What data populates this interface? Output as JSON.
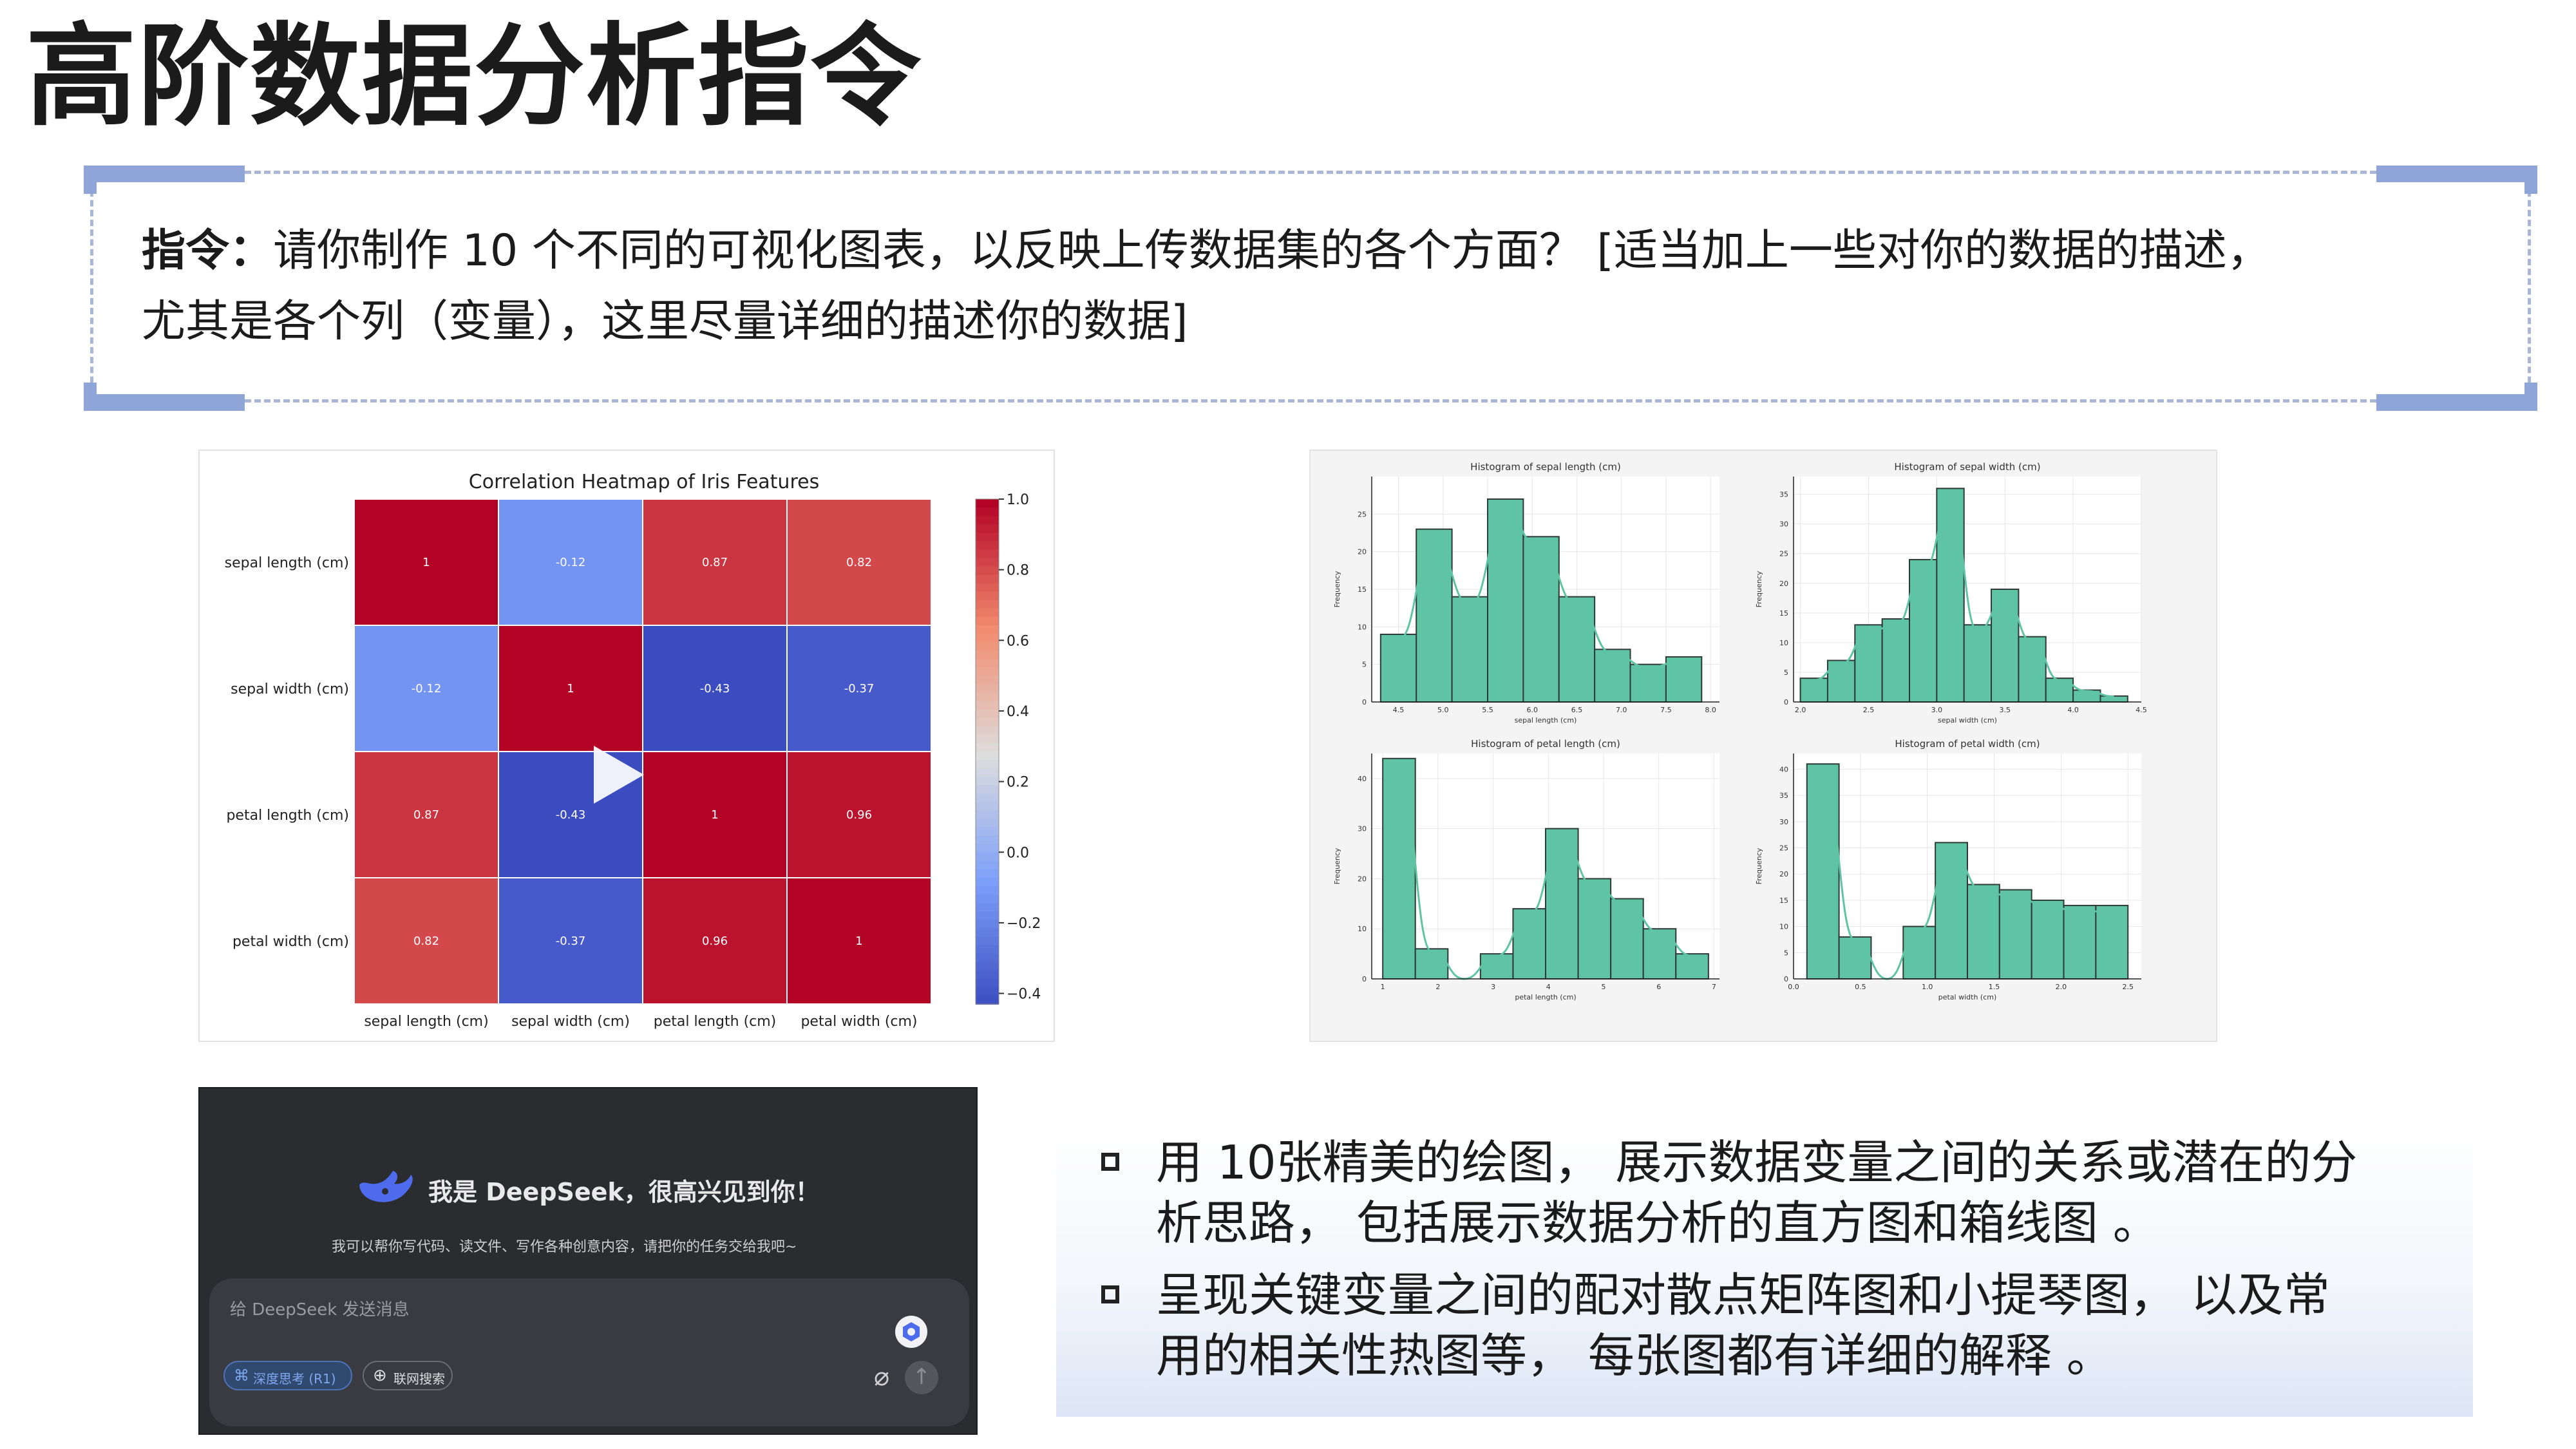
{
  "page": {
    "title": "高阶数据分析指令"
  },
  "instruction": {
    "label": "指令：",
    "line1": "请你制作 10 个不同的可视化图表，以反映上传数据集的各个方面？ [适当加上一些对你的数据的描述，",
    "line2": "尤其是各个列（变量），这里尽量详细的描述你的数据]"
  },
  "colors": {
    "accent": "#8fa5d8",
    "hist_fill": "#5fc4a3",
    "heat_high": "#b40426",
    "heat_low": "#3b4cc0"
  },
  "chart_data": [
    {
      "type": "heatmap",
      "title": "Correlation Heatmap of Iris Features",
      "rows": [
        "sepal length (cm)",
        "sepal width (cm)",
        "petal length (cm)",
        "petal width (cm)"
      ],
      "cols": [
        "sepal length (cm)",
        "sepal width (cm)",
        "petal length (cm)",
        "petal width (cm)"
      ],
      "values": [
        [
          1,
          -0.12,
          0.87,
          0.82
        ],
        [
          -0.12,
          1,
          -0.43,
          -0.37
        ],
        [
          0.87,
          -0.43,
          1,
          0.96
        ],
        [
          0.82,
          -0.37,
          0.96,
          1
        ]
      ],
      "labels": [
        [
          "1",
          "-0.12",
          "0.87",
          "0.82"
        ],
        [
          "-0.12",
          "1",
          "-0.43",
          "-0.37"
        ],
        [
          "0.87",
          "-0.43",
          "1",
          "0.96"
        ],
        [
          "0.82",
          "-0.37",
          "0.96",
          "1"
        ]
      ],
      "colorbar_ticks": [
        "1.0",
        "0.8",
        "0.6",
        "0.4",
        "0.2",
        "0.0",
        "−0.2",
        "−0.4"
      ],
      "colorbar_range": [
        -0.43,
        1.0
      ]
    },
    {
      "type": "bar",
      "title": "Histogram of sepal length (cm)",
      "xlabel": "sepal length (cm)",
      "ylabel": "Frequency",
      "xticks": [
        "4.5",
        "5.0",
        "5.5",
        "6.0",
        "6.5",
        "7.0",
        "7.5",
        "8.0"
      ],
      "yticks": [
        "0",
        "5",
        "10",
        "15",
        "20",
        "25"
      ],
      "xlim": [
        4.2,
        8.1
      ],
      "ylim": [
        0,
        30
      ],
      "bins": [
        [
          4.3,
          4.7,
          9
        ],
        [
          4.7,
          5.1,
          23
        ],
        [
          5.1,
          5.5,
          14
        ],
        [
          5.5,
          5.9,
          27
        ],
        [
          5.9,
          6.3,
          22
        ],
        [
          6.3,
          6.7,
          14
        ],
        [
          6.7,
          7.1,
          7
        ],
        [
          7.1,
          7.5,
          5
        ],
        [
          7.5,
          7.9,
          6
        ]
      ]
    },
    {
      "type": "bar",
      "title": "Histogram of sepal width (cm)",
      "xlabel": "sepal width (cm)",
      "ylabel": "Frequency",
      "xticks": [
        "2.0",
        "2.5",
        "3.0",
        "3.5",
        "4.0",
        "4.5"
      ],
      "yticks": [
        "0",
        "5",
        "10",
        "15",
        "20",
        "25",
        "30",
        "35"
      ],
      "xlim": [
        1.95,
        4.5
      ],
      "ylim": [
        0,
        38
      ],
      "bins": [
        [
          2.0,
          2.2,
          4
        ],
        [
          2.2,
          2.4,
          7
        ],
        [
          2.4,
          2.6,
          13
        ],
        [
          2.6,
          2.8,
          14
        ],
        [
          2.8,
          3.0,
          24
        ],
        [
          3.0,
          3.2,
          36
        ],
        [
          3.2,
          3.4,
          13
        ],
        [
          3.4,
          3.6,
          19
        ],
        [
          3.6,
          3.8,
          11
        ],
        [
          3.8,
          4.0,
          4
        ],
        [
          4.0,
          4.2,
          2
        ],
        [
          4.2,
          4.4,
          1
        ]
      ]
    },
    {
      "type": "bar",
      "title": "Histogram of petal length (cm)",
      "xlabel": "petal length (cm)",
      "ylabel": "Frequency",
      "xticks": [
        "1",
        "2",
        "3",
        "4",
        "5",
        "6",
        "7"
      ],
      "yticks": [
        "0",
        "10",
        "20",
        "30",
        "40"
      ],
      "xlim": [
        0.8,
        7.1
      ],
      "ylim": [
        0,
        45
      ],
      "bins": [
        [
          1.0,
          1.59,
          44
        ],
        [
          1.59,
          2.18,
          6
        ],
        [
          2.18,
          2.77,
          0
        ],
        [
          2.77,
          3.36,
          5
        ],
        [
          3.36,
          3.95,
          14
        ],
        [
          3.95,
          4.54,
          30
        ],
        [
          4.54,
          5.13,
          20
        ],
        [
          5.13,
          5.72,
          16
        ],
        [
          5.72,
          6.31,
          10
        ],
        [
          6.31,
          6.9,
          5
        ]
      ]
    },
    {
      "type": "bar",
      "title": "Histogram of petal width (cm)",
      "xlabel": "petal width (cm)",
      "ylabel": "Frequency",
      "xticks": [
        "0.0",
        "0.5",
        "1.0",
        "1.5",
        "2.0",
        "2.5"
      ],
      "yticks": [
        "0",
        "5",
        "10",
        "15",
        "20",
        "25",
        "30",
        "35",
        "40"
      ],
      "xlim": [
        0.0,
        2.6
      ],
      "ylim": [
        0,
        43
      ],
      "bins": [
        [
          0.1,
          0.34,
          41
        ],
        [
          0.34,
          0.58,
          8
        ],
        [
          0.58,
          0.82,
          0
        ],
        [
          0.82,
          1.06,
          10
        ],
        [
          1.06,
          1.3,
          26
        ],
        [
          1.3,
          1.54,
          18
        ],
        [
          1.54,
          1.78,
          17
        ],
        [
          1.78,
          2.02,
          15
        ],
        [
          2.02,
          2.26,
          14
        ],
        [
          2.26,
          2.5,
          14
        ]
      ]
    }
  ],
  "deepseek": {
    "greeting": "我是 DeepSeek，很高兴见到你！",
    "subtitle": "我可以帮你写代码、读文件、写作各种创意内容，请把你的任务交给我吧~",
    "input_placeholder": "给 DeepSeek 发送消息",
    "deep_think": "深度思考 (R1)",
    "web_search": "联网搜索",
    "logo_icon": "whale-icon",
    "attach_icon": "paperclip-icon",
    "send_icon": "arrow-up-icon"
  },
  "bullets": [
    {
      "line1": "用 10张精美的绘图， 展示数据变量之间的关系或潜在的分",
      "line2": "析思路， 包括展示数据分析的直方图和箱线图 。"
    },
    {
      "line1": "呈现关键变量之间的配对散点矩阵图和小提琴图， 以及常",
      "line2": "用的相关性热图等， 每张图都有详细的解释 。"
    }
  ]
}
